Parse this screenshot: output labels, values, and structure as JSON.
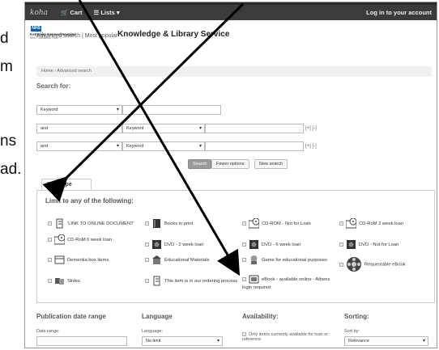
{
  "slide_fragment": {
    "line1": "d",
    "line2": "m",
    "line3": "ns",
    "line4": "ad."
  },
  "navbar": {
    "logo": "koha",
    "cart": "Cart",
    "lists": "Lists",
    "login": "Log in to your account"
  },
  "header": {
    "nhs": "NHS",
    "hospital": "Kettering General Hospital",
    "trust": "NHS Foundation Trust",
    "service": "Knowledge & Library Service",
    "links": "Advanced search | Most popular"
  },
  "breadcrumb": {
    "home": "Home",
    "sep": "›",
    "current": "Advanced search"
  },
  "search_for": "Search for:",
  "rows": [
    {
      "field": "Keyword"
    },
    {
      "op": "and",
      "field": "Keyword",
      "pm": "[+] [-]"
    },
    {
      "op": "and",
      "field": "Keyword",
      "pm": "[+] [-]"
    }
  ],
  "buttons": {
    "search": "Search",
    "fewer": "Fewer options",
    "new": "New search"
  },
  "tab": "Item type",
  "limit": "Limit to any of the following:",
  "items": [
    {
      "label": "'LINK TO ONLINE DOCUMENT'",
      "icon": "link-doc-icon"
    },
    {
      "label": "Books in print",
      "icon": "book-icon"
    },
    {
      "label": "CD-ROM - Not for Loan",
      "icon": "cd-icon"
    },
    {
      "label": "CD-RoM 2 week loan",
      "icon": "cd-icon"
    },
    {
      "label": "CD-RoM 6 week loan",
      "icon": "cd-icon"
    },
    {
      "label": "DVD - 2 week loan",
      "icon": "dvd-icon"
    },
    {
      "label": "DVD - 6 week loan",
      "icon": "dvd-icon"
    },
    {
      "label": "DVD - Not for Loan",
      "icon": "dvd-icon"
    },
    {
      "label": "Dementia box items",
      "icon": "kit-icon"
    },
    {
      "label": "Educational Materials",
      "icon": "building-icon"
    },
    {
      "label": "Game for educational purposes",
      "icon": "game-icon"
    },
    {
      "label": "Requestable eBook",
      "icon": "reel-icon"
    },
    {
      "label": "Slides",
      "icon": "slides-icon"
    },
    {
      "label": "This item is in our ordering process",
      "icon": "ordering-icon"
    },
    {
      "label": "eBook - available online - Athens login required",
      "icon": "ebook-icon"
    }
  ],
  "sections": {
    "pubdate": "Publication date range",
    "language": "Language",
    "availability": "Availability:",
    "sorting": "Sorting:",
    "date_range": "Date range:",
    "language_lbl": "Language:",
    "language_val": "No limit",
    "avail_text": "Only items currently available for loan or reference",
    "sort_by": "Sort by:",
    "sort_val": "Relevance"
  }
}
